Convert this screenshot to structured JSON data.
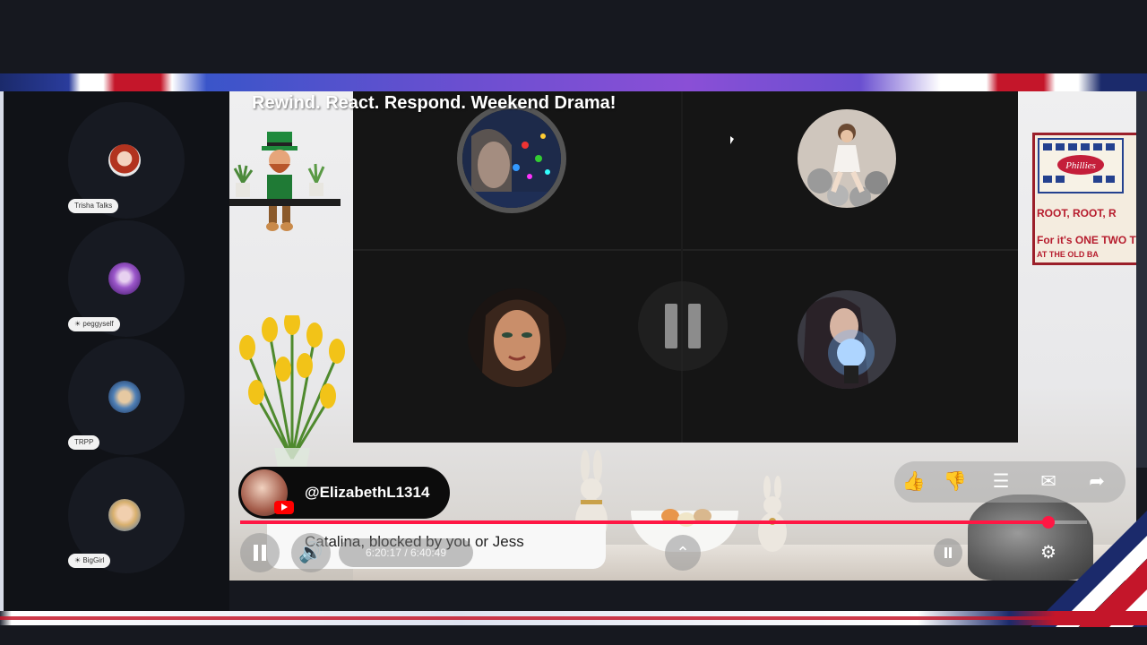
{
  "stream": {
    "title": "Rewind. React. Respond. Weekend Drama!"
  },
  "sidebar": {
    "speakers": [
      {
        "label": "Trisha Talks"
      },
      {
        "label": "☀ peggyself"
      },
      {
        "label": "TRPP"
      },
      {
        "label": "☀ BigGirl"
      }
    ]
  },
  "phillies_sign": {
    "rows": [
      "ROOT, ROOT, R",
      "For it's ONE TWO TH",
      "AT THE OLD BA"
    ]
  },
  "channel": {
    "handle": "@ElizabethL1314"
  },
  "player": {
    "caption": "Catalina, blocked by you or Jess",
    "time": "6:20:17 / 6:40:49",
    "progress": 0.955
  },
  "actions": [
    {
      "name": "like",
      "glyph": "👍"
    },
    {
      "name": "dislike",
      "glyph": "👎"
    },
    {
      "name": "comments",
      "glyph": "☰"
    },
    {
      "name": "chat",
      "glyph": "✉"
    },
    {
      "name": "share",
      "glyph": "➦"
    }
  ],
  "colors": {
    "accent_red": "#ff1744",
    "youtube_red": "#ff0000",
    "banner_blue": "#1b2a6b"
  }
}
